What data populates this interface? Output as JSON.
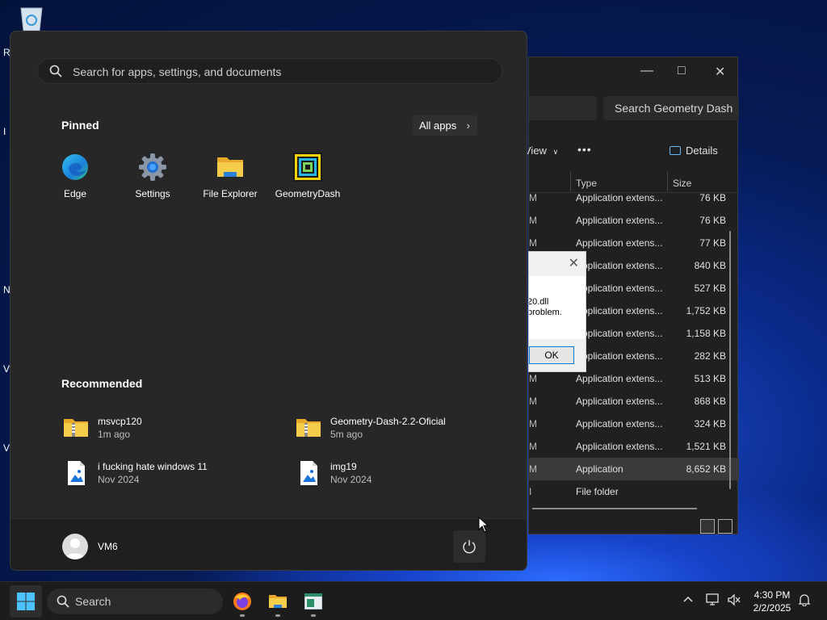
{
  "explorer": {
    "search_placeholder": "Search Geometry Dash",
    "view_label": "View",
    "more_label": "•••",
    "details_label": "Details",
    "col_type": "Type",
    "col_size": "Size",
    "rows": [
      {
        "m": "M",
        "type": "Application extens...",
        "size": "76 KB"
      },
      {
        "m": "M",
        "type": "Application extens...",
        "size": "76 KB"
      },
      {
        "m": "M",
        "type": "Application extens...",
        "size": "77 KB"
      },
      {
        "m": "M",
        "type": "Application extens...",
        "size": "840 KB"
      },
      {
        "m": "M",
        "type": "Application extens...",
        "size": "527 KB"
      },
      {
        "m": "M",
        "type": "Application extens...",
        "size": "1,752 KB"
      },
      {
        "m": "M",
        "type": "Application extens...",
        "size": "1,158 KB"
      },
      {
        "m": "M",
        "type": "Application extens...",
        "size": "282 KB"
      },
      {
        "m": "M",
        "type": "Application extens...",
        "size": "513 KB"
      },
      {
        "m": "M",
        "type": "Application extens...",
        "size": "868 KB"
      },
      {
        "m": "M",
        "type": "Application extens...",
        "size": "324 KB"
      },
      {
        "m": "M",
        "type": "Application extens...",
        "size": "1,521 KB"
      },
      {
        "m": "M",
        "type": "Application",
        "size": "8,652 KB"
      },
      {
        "m": "I",
        "type": "File folder",
        "size": ""
      }
    ]
  },
  "dialog": {
    "line1": "20.dll",
    "line2": "problem.",
    "ok_label": "OK"
  },
  "start": {
    "search_placeholder": "Search for apps, settings, and documents",
    "pinned_title": "Pinned",
    "all_apps_label": "All apps",
    "pinned": [
      {
        "label": "Edge"
      },
      {
        "label": "Settings"
      },
      {
        "label": "File Explorer"
      },
      {
        "label": "GeometryDash"
      }
    ],
    "recommended_title": "Recommended",
    "recommended": [
      {
        "name": "msvcp120",
        "time": "1m ago"
      },
      {
        "name": "Geometry-Dash-2.2-Oficial",
        "time": "5m ago"
      },
      {
        "name": "i fucking hate windows 11",
        "time": "Nov 2024"
      },
      {
        "name": "img19",
        "time": "Nov 2024"
      }
    ],
    "user_name": "VM6"
  },
  "taskbar": {
    "search_label": "Search",
    "time": "4:30 PM",
    "date": "2/2/2025"
  },
  "colors": {
    "accent": "#0078d4",
    "folder_yellow": "#f3c33a",
    "start_bg": "#272727"
  }
}
